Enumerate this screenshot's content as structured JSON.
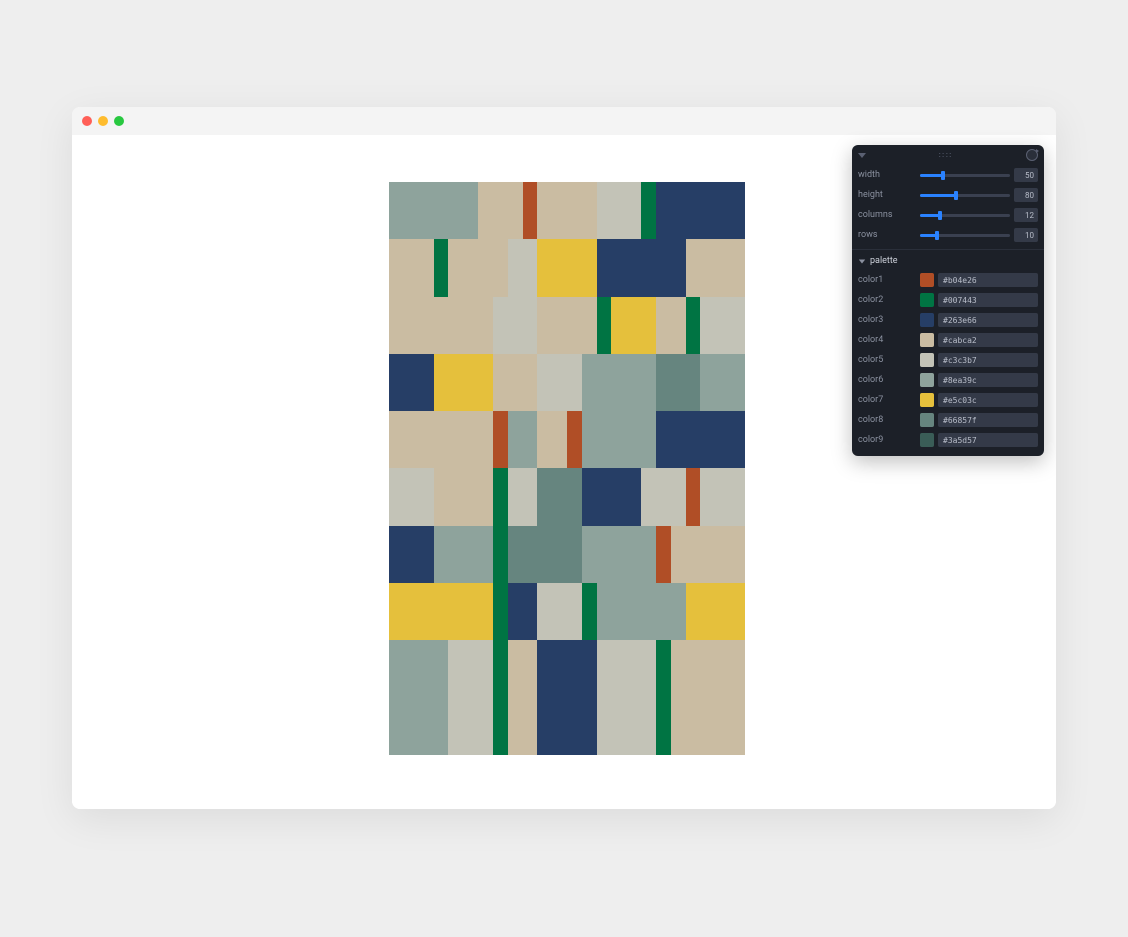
{
  "panel": {
    "sliders": [
      {
        "label": "width",
        "value": 50,
        "min": 0,
        "max": 200
      },
      {
        "label": "height",
        "value": 80,
        "min": 0,
        "max": 200
      },
      {
        "label": "columns",
        "value": 12,
        "min": 1,
        "max": 50
      },
      {
        "label": "rows",
        "value": 10,
        "min": 1,
        "max": 50
      }
    ],
    "folder_label": "palette",
    "colors": [
      {
        "label": "color1",
        "hex": "#b04e26"
      },
      {
        "label": "color2",
        "hex": "#007443"
      },
      {
        "label": "color3",
        "hex": "#263e66"
      },
      {
        "label": "color4",
        "hex": "#cabca2"
      },
      {
        "label": "color5",
        "hex": "#c3c3b7"
      },
      {
        "label": "color6",
        "hex": "#8ea39c"
      },
      {
        "label": "color7",
        "hex": "#e5c03c"
      },
      {
        "label": "color8",
        "hex": "#66857f"
      },
      {
        "label": "color9",
        "hex": "#3a5d57"
      }
    ]
  },
  "artwork": {
    "rows": [
      [
        {
          "c": "#8ea39c",
          "w": 6
        },
        {
          "c": "#cabca2",
          "w": 3
        },
        {
          "c": "#b04e26",
          "w": 1
        },
        {
          "c": "#cabca2",
          "w": 4
        },
        {
          "c": "#c3c3b7",
          "w": 3
        },
        {
          "c": "#007443",
          "w": 1
        },
        {
          "c": "#263e66",
          "w": 6
        }
      ],
      [
        {
          "c": "#cabca2",
          "w": 3
        },
        {
          "c": "#007443",
          "w": 1
        },
        {
          "c": "#cabca2",
          "w": 4
        },
        {
          "c": "#c3c3b7",
          "w": 2
        },
        {
          "c": "#e5c03c",
          "w": 4
        },
        {
          "c": "#263e66",
          "w": 6
        },
        {
          "c": "#cabca2",
          "w": 4
        }
      ],
      [
        {
          "c": "#cabca2",
          "w": 7
        },
        {
          "c": "#c3c3b7",
          "w": 3
        },
        {
          "c": "#cabca2",
          "w": 4
        },
        {
          "c": "#007443",
          "w": 1
        },
        {
          "c": "#e5c03c",
          "w": 3
        },
        {
          "c": "#cabca2",
          "w": 2
        },
        {
          "c": "#007443",
          "w": 1
        },
        {
          "c": "#c3c3b7",
          "w": 3
        }
      ],
      [
        {
          "c": "#263e66",
          "w": 3
        },
        {
          "c": "#e5c03c",
          "w": 4
        },
        {
          "c": "#cabca2",
          "w": 3
        },
        {
          "c": "#c3c3b7",
          "w": 3
        },
        {
          "c": "#8ea39c",
          "w": 5
        },
        {
          "c": "#66857f",
          "w": 3
        },
        {
          "c": "#8ea39c",
          "w": 3
        }
      ],
      [
        {
          "c": "#cabca2",
          "w": 7
        },
        {
          "c": "#b04e26",
          "w": 1
        },
        {
          "c": "#8ea39c",
          "w": 2
        },
        {
          "c": "#cabca2",
          "w": 2
        },
        {
          "c": "#b04e26",
          "w": 1
        },
        {
          "c": "#8ea39c",
          "w": 5
        },
        {
          "c": "#263e66",
          "w": 6
        }
      ],
      [
        {
          "c": "#c3c3b7",
          "w": 3
        },
        {
          "c": "#cabca2",
          "w": 4
        },
        {
          "c": "#007443",
          "w": 1
        },
        {
          "c": "#c3c3b7",
          "w": 2
        },
        {
          "c": "#66857f",
          "w": 3
        },
        {
          "c": "#263e66",
          "w": 4
        },
        {
          "c": "#c3c3b7",
          "w": 3
        },
        {
          "c": "#b04e26",
          "w": 1
        },
        {
          "c": "#c3c3b7",
          "w": 3
        }
      ],
      [
        {
          "c": "#263e66",
          "w": 3
        },
        {
          "c": "#8ea39c",
          "w": 4
        },
        {
          "c": "#007443",
          "w": 1
        },
        {
          "c": "#66857f",
          "w": 5
        },
        {
          "c": "#8ea39c",
          "w": 5
        },
        {
          "c": "#b04e26",
          "w": 1
        },
        {
          "c": "#cabca2",
          "w": 5
        }
      ],
      [
        {
          "c": "#e5c03c",
          "w": 7
        },
        {
          "c": "#007443",
          "w": 1
        },
        {
          "c": "#263e66",
          "w": 2
        },
        {
          "c": "#c3c3b7",
          "w": 3
        },
        {
          "c": "#007443",
          "w": 1
        },
        {
          "c": "#8ea39c",
          "w": 6
        },
        {
          "c": "#e5c03c",
          "w": 4
        }
      ],
      [
        {
          "c": "#8ea39c",
          "w": 4
        },
        {
          "c": "#c3c3b7",
          "w": 3
        },
        {
          "c": "#007443",
          "w": 1
        },
        {
          "c": "#cabca2",
          "w": 2
        },
        {
          "c": "#263e66",
          "w": 4
        },
        {
          "c": "#c3c3b7",
          "w": 4
        },
        {
          "c": "#007443",
          "w": 1
        },
        {
          "c": "#cabca2",
          "w": 5
        }
      ],
      [
        {
          "c": "#8ea39c",
          "w": 4
        },
        {
          "c": "#c3c3b7",
          "w": 3
        },
        {
          "c": "#007443",
          "w": 1
        },
        {
          "c": "#cabca2",
          "w": 2
        },
        {
          "c": "#263e66",
          "w": 4
        },
        {
          "c": "#c3c3b7",
          "w": 4
        },
        {
          "c": "#007443",
          "w": 1
        },
        {
          "c": "#cabca2",
          "w": 5
        }
      ]
    ]
  }
}
